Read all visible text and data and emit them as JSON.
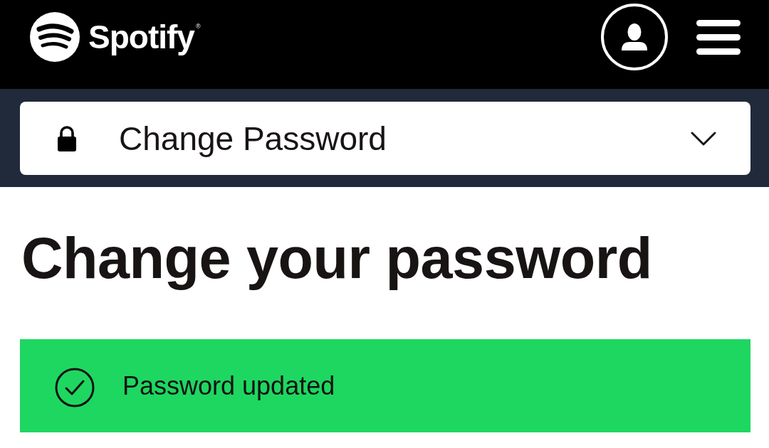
{
  "header": {
    "logo": {
      "wordmark": "Spotify$^{®}$"
    }
  },
  "section_selector": {
    "label": "Change Password",
    "expanded": false
  },
  "heading": "Change your password",
  "alert": {
    "message": "Password updated"
  }
}
